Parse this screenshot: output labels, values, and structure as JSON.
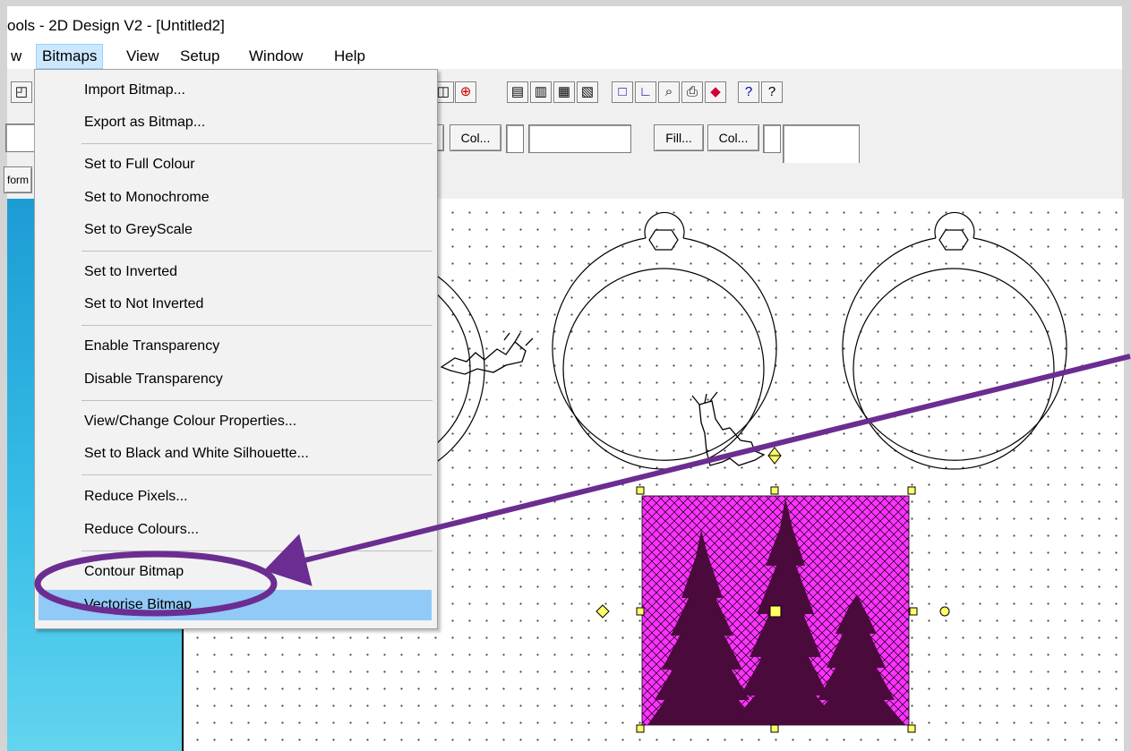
{
  "window": {
    "title": "ools - 2D Design V2 - [Untitled2]"
  },
  "menubar": {
    "items": [
      "w",
      "Bitmaps",
      "View",
      "Setup",
      "Window",
      "Help"
    ],
    "active": "Bitmaps"
  },
  "dropdown": {
    "items": [
      "Import Bitmap...",
      "Export as Bitmap...",
      "Set to Full Colour",
      "Set to Monochrome",
      "Set to GreyScale",
      "Set to Inverted",
      "Set to Not Inverted",
      "Enable Transparency",
      "Disable Transparency",
      "View/Change Colour Properties...",
      "Set to Black and White Silhouette...",
      "Reduce Pixels...",
      "Reduce Colours...",
      "Contour Bitmap",
      "Vectorise Bitmap"
    ],
    "highlighted": "Vectorise Bitmap"
  },
  "toolbar": {
    "col_label_1": "Col...",
    "fill_label": "Fill...",
    "col_label_2": "Col...",
    "clipped_label": "form"
  },
  "annotation": {
    "color": "#6b2d91"
  },
  "selection": {
    "fill_color": "#ff33ff",
    "handle_color": "#ffff66"
  }
}
